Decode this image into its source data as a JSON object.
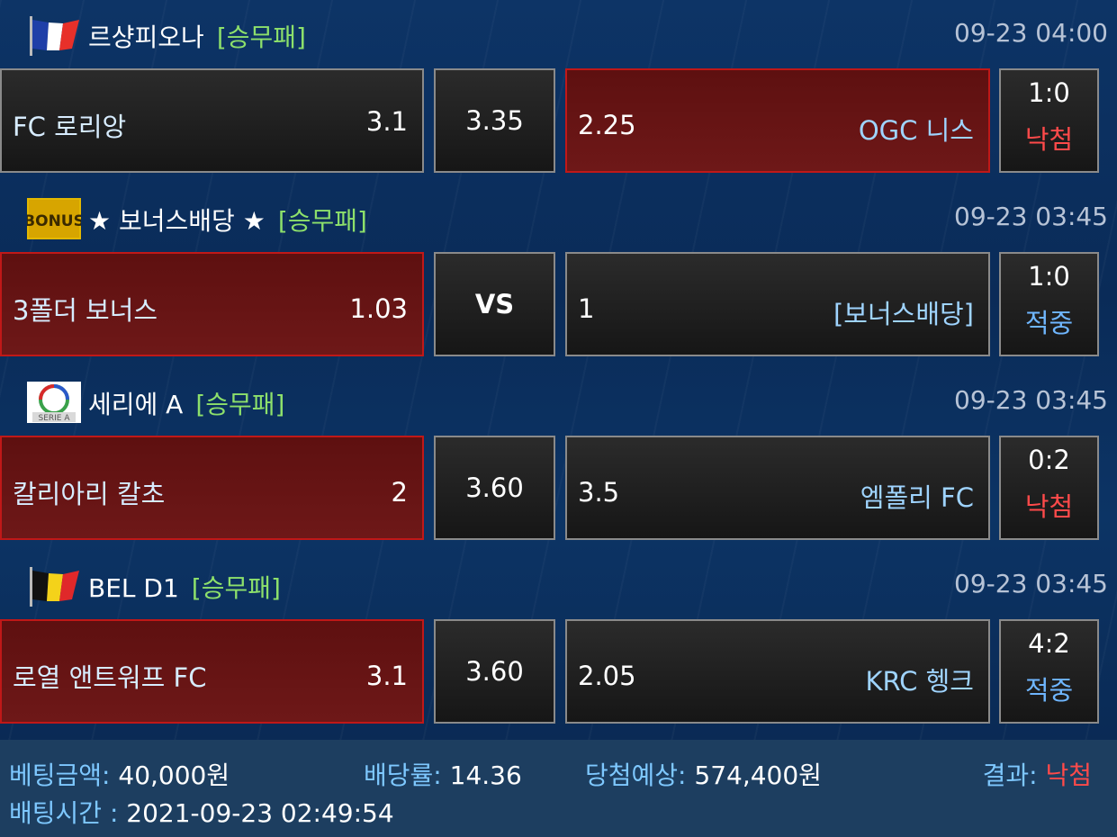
{
  "matches": [
    {
      "league_icon": "france-flag-icon",
      "league": "르샹피오나",
      "bet_type": "[승무패]",
      "time": "09-23 04:00",
      "home": "FC 로리앙",
      "home_odds": "3.1",
      "draw": "3.35",
      "away_odds": "2.25",
      "away": "OGC 니스",
      "score": "1:0",
      "status": "낙첨",
      "status_kind": "lose",
      "selected": "away"
    },
    {
      "league_icon": "bonus-icon",
      "league": "★ 보너스배당 ★",
      "bet_type": "[승무패]",
      "time": "09-23 03:45",
      "home": "3폴더 보너스",
      "home_odds": "1.03",
      "draw": "VS",
      "away_odds": "1",
      "away": "[보너스배당]",
      "score": "1:0",
      "status": "적중",
      "status_kind": "win",
      "selected": "home"
    },
    {
      "league_icon": "serie-a-icon",
      "league": "세리에 A",
      "bet_type": "[승무패]",
      "time": "09-23 03:45",
      "home": "칼리아리 칼초",
      "home_odds": "2",
      "draw": "3.60",
      "away_odds": "3.5",
      "away": "엠폴리 FC",
      "score": "0:2",
      "status": "낙첨",
      "status_kind": "lose",
      "selected": "home"
    },
    {
      "league_icon": "belgium-flag-icon",
      "league": "BEL D1",
      "bet_type": "[승무패]",
      "time": "09-23 03:45",
      "home": "로열 앤트워프 FC",
      "home_odds": "3.1",
      "draw": "3.60",
      "away_odds": "2.05",
      "away": "KRC 헹크",
      "score": "4:2",
      "status": "적중",
      "status_kind": "win",
      "selected": "home"
    }
  ],
  "footer": {
    "bet_amount_label": "베팅금액:",
    "bet_amount": "40,000원",
    "odds_label": "배당률:",
    "odds": "14.36",
    "expected_label": "당첨예상:",
    "expected": "574,400원",
    "result_label": "결과:",
    "result": "낙첨",
    "bet_time_label": "배팅시간 :",
    "bet_time": "2021-09-23 02:49:54"
  },
  "colors": {
    "selected_border": "#c01818",
    "bet_type": "#8de06b",
    "lose": "#ff4a4a",
    "win": "#6fb6ff"
  }
}
